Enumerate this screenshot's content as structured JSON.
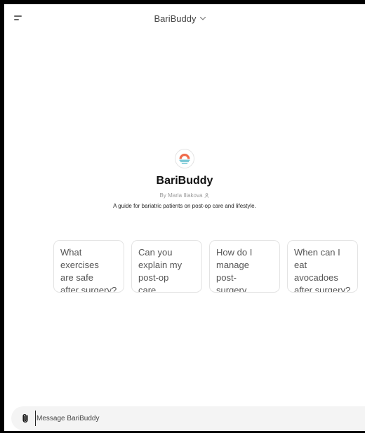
{
  "header": {
    "title": "BariBuddy",
    "menu_icon": "sidebar-menu-icon",
    "chevron_icon": "chevron-down-icon"
  },
  "gpt": {
    "name": "BariBuddy",
    "author": "By Maria Iliakova",
    "description": "A guide for bariatric patients on post-op care and lifestyle."
  },
  "suggestions": [
    {
      "text": "What exercises\nare safe\nafter surgery?"
    },
    {
      "text": "Can you\nexplain my\npost-op care..."
    },
    {
      "text": "How do I\nmanage\npost-surgery..."
    },
    {
      "text": "When can I\neat avocadoes\nafter surgery?"
    }
  ],
  "composer": {
    "placeholder": "Message BariBuddy",
    "attach_icon": "paperclip-icon"
  },
  "colors": {
    "logo_orange": "#ef6a4a",
    "logo_teal": "#53b8c9",
    "background": "#ffffff",
    "composer_bg": "#f4f4f4"
  }
}
